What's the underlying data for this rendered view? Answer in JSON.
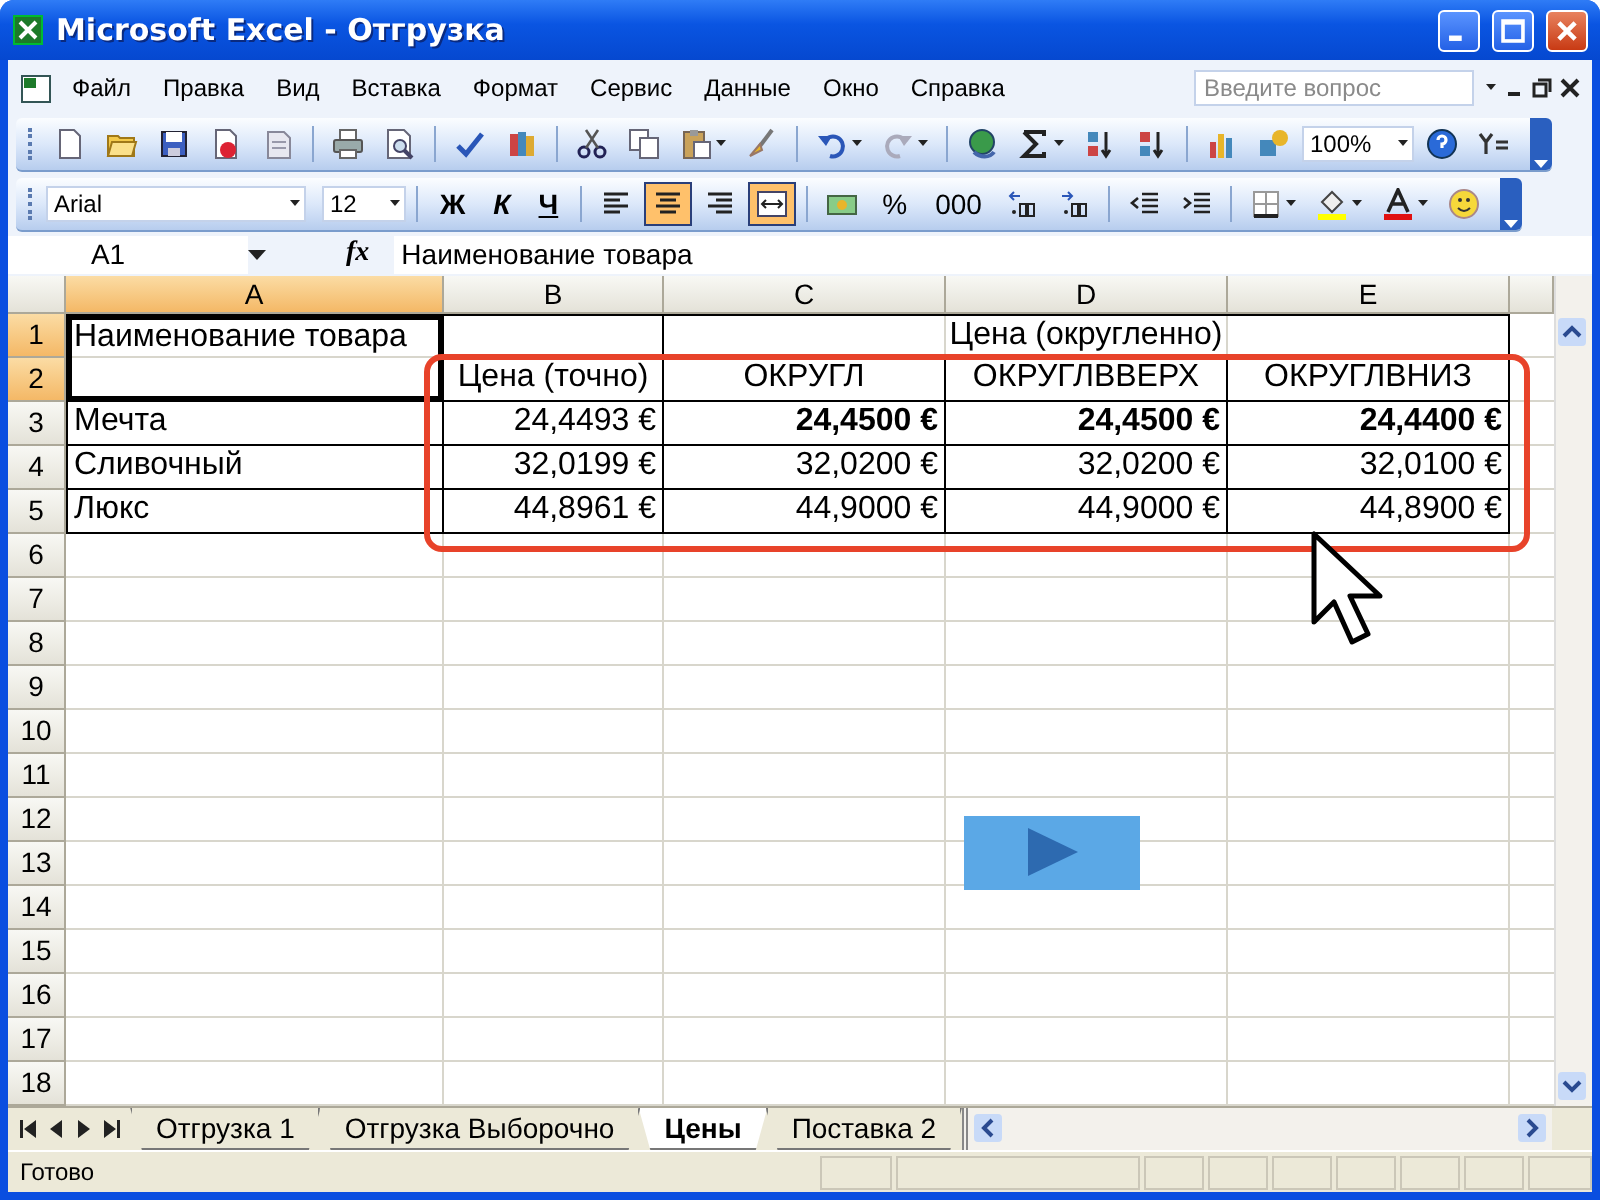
{
  "window": {
    "title": "Microsoft Excel - Отгрузка"
  },
  "menu": {
    "items": [
      "Файл",
      "Правка",
      "Вид",
      "Вставка",
      "Формат",
      "Сервис",
      "Данные",
      "Окно",
      "Справка"
    ],
    "help_search": {
      "placeholder": "Введите вопрос"
    }
  },
  "standard_toolbar": {
    "zoom": "100%"
  },
  "formatting_toolbar": {
    "font": "Arial",
    "size": "12",
    "style_buttons": [
      {
        "kind": "bold",
        "label": "Ж",
        "pressed": false
      },
      {
        "kind": "italic",
        "label": "К",
        "pressed": false
      },
      {
        "kind": "underline",
        "label": "Ч",
        "pressed": false
      }
    ],
    "align_buttons": [
      {
        "kind": "left",
        "pressed": false
      },
      {
        "kind": "center",
        "pressed": true
      },
      {
        "kind": "right",
        "pressed": false
      },
      {
        "kind": "merge",
        "pressed": true
      }
    ],
    "number_buttons": [
      "%",
      "000"
    ]
  },
  "formula_bar": {
    "name_box": "A1",
    "fx": "fx",
    "formula": "Наименование товара"
  },
  "sheet": {
    "columns": [
      {
        "label": "A",
        "selected": true
      },
      {
        "label": "B",
        "selected": false
      },
      {
        "label": "C",
        "selected": false
      },
      {
        "label": "D",
        "selected": false
      },
      {
        "label": "E",
        "selected": false
      }
    ],
    "rows": [
      {
        "label": "1",
        "selected": true
      },
      {
        "label": "2",
        "selected": true
      },
      {
        "label": "3",
        "selected": false
      },
      {
        "label": "4",
        "selected": false
      },
      {
        "label": "5",
        "selected": false
      },
      {
        "label": "6",
        "selected": false
      },
      {
        "label": "7",
        "selected": false
      },
      {
        "label": "8",
        "selected": false
      },
      {
        "label": "9",
        "selected": false
      },
      {
        "label": "10",
        "selected": false
      },
      {
        "label": "11",
        "selected": false
      },
      {
        "label": "12",
        "selected": false
      },
      {
        "label": "13",
        "selected": false
      },
      {
        "label": "14",
        "selected": false
      },
      {
        "label": "15",
        "selected": false
      },
      {
        "label": "16",
        "selected": false
      },
      {
        "label": "17",
        "selected": false
      },
      {
        "label": "18",
        "selected": false
      }
    ],
    "table_rows": [
      {
        "cells": [
          {
            "kind": "label",
            "text": "Наименование товара",
            "bold": false,
            "merge_down": true
          },
          {},
          {
            "kind": "header",
            "text": "Цена (округленно)",
            "bold": false,
            "merge_right": true
          },
          {},
          {}
        ]
      },
      {
        "cells": [
          {},
          {
            "kind": "header",
            "text": "Цена (точно)",
            "bold": false
          },
          {
            "kind": "header",
            "text": "ОКРУГЛ",
            "bold": false
          },
          {
            "kind": "header",
            "text": "ОКРУГЛВВЕРХ",
            "bold": false
          },
          {
            "kind": "header",
            "text": "ОКРУГЛВНИЗ",
            "bold": false
          }
        ]
      },
      {
        "cells": [
          {
            "kind": "label",
            "text": "Мечта",
            "bold": false
          },
          {
            "kind": "number",
            "text": "24,4493 €",
            "bold": false
          },
          {
            "kind": "number",
            "text": "24,4500 €",
            "bold": true
          },
          {
            "kind": "number",
            "text": "24,4500 €",
            "bold": true
          },
          {
            "kind": "number",
            "text": "24,4400 €",
            "bold": true
          }
        ]
      },
      {
        "cells": [
          {
            "kind": "label",
            "text": "Сливочный",
            "bold": false
          },
          {
            "kind": "number",
            "text": "32,0199 €",
            "bold": false
          },
          {
            "kind": "number",
            "text": "32,0200 €",
            "bold": false
          },
          {
            "kind": "number",
            "text": "32,0200 €",
            "bold": false
          },
          {
            "kind": "number",
            "text": "32,0100 €",
            "bold": false
          }
        ]
      },
      {
        "cells": [
          {
            "kind": "label",
            "text": "Люкс",
            "bold": false
          },
          {
            "kind": "number",
            "text": "44,8961 €",
            "bold": false
          },
          {
            "kind": "number",
            "text": "44,9000 €",
            "bold": false
          },
          {
            "kind": "number",
            "text": "44,9000 €",
            "bold": false
          },
          {
            "kind": "number",
            "text": "44,8900 €",
            "bold": false
          }
        ]
      }
    ]
  },
  "sheet_tabs": [
    {
      "label": "Отгрузка 1",
      "selected": false
    },
    {
      "label": "Отгрузка Выборочно",
      "selected": false
    },
    {
      "label": "Цены",
      "selected": true
    },
    {
      "label": "Поставка 2",
      "selected": false
    }
  ],
  "status_bar": {
    "text": "Готово"
  }
}
